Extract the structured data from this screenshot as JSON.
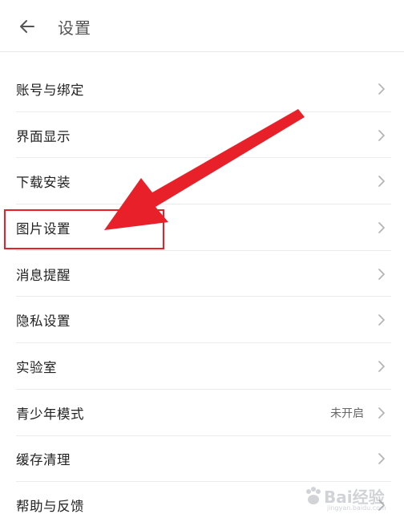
{
  "header": {
    "title": "设置",
    "back_icon": "arrow-left-icon"
  },
  "settings": {
    "items": [
      {
        "label": "账号与绑定",
        "value": ""
      },
      {
        "label": "界面显示",
        "value": ""
      },
      {
        "label": "下载安装",
        "value": ""
      },
      {
        "label": "图片设置",
        "value": "",
        "highlighted": true
      },
      {
        "label": "消息提醒",
        "value": ""
      },
      {
        "label": "隐私设置",
        "value": ""
      },
      {
        "label": "实验室",
        "value": ""
      },
      {
        "label": "青少年模式",
        "value": "未开启"
      },
      {
        "label": "缓存清理",
        "value": ""
      },
      {
        "label": "帮助与反馈",
        "value": ""
      }
    ]
  },
  "annotation": {
    "arrow_color": "#e8202a",
    "box_color": "#e8202a",
    "target": "图片设置"
  },
  "watermark": {
    "text": "Bai经验",
    "sub": "jingyan.baidu.com"
  },
  "colors": {
    "background": "#ffffff",
    "divider": "#ececec",
    "chevron": "#b5b5b5",
    "title": "#555555"
  }
}
